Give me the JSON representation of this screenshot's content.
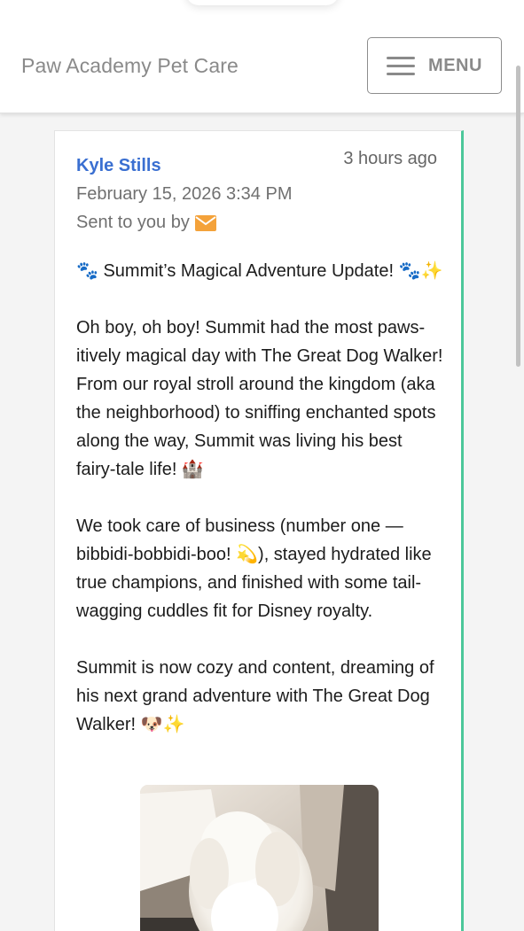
{
  "header": {
    "brand": "Paw Academy Pet Care",
    "menu_label": "MENU",
    "menu_icon": "hamburger-icon"
  },
  "message": {
    "sender": "Kyle Stills",
    "time_ago": "3 hours ago",
    "datetime": "February 15, 2026 3:34 PM",
    "sent_via_label": "Sent to you by",
    "sent_via_icon": "envelope-icon",
    "paragraphs": [
      "🐾 Summit’s Magical Adventure Update! 🐾✨",
      "Oh boy, oh boy! Summit had the most paws-itively magical day with The Great Dog Walker! From our royal stroll around the kingdom (aka the neighborhood) to sniffing enchanted spots along the way, Summit was living his best fairy-tale life! 🏰",
      "We took care of business (number one — bibbidi-bobbidi-boo! 💫), stayed hydrated like true champions, and finished with some tail-wagging cuddles fit for Disney royalty.",
      "Summit is now cozy and content, dreaming of his next grand adventure with The Great Dog Walker! 🐶✨"
    ],
    "photo_subject": "white-fluffy-dog-photo"
  },
  "colors": {
    "sender": "#3a6fd1",
    "accent_border": "#4cc79a",
    "envelope": "#f4a23a",
    "brand_text": "#8a8a8a"
  }
}
